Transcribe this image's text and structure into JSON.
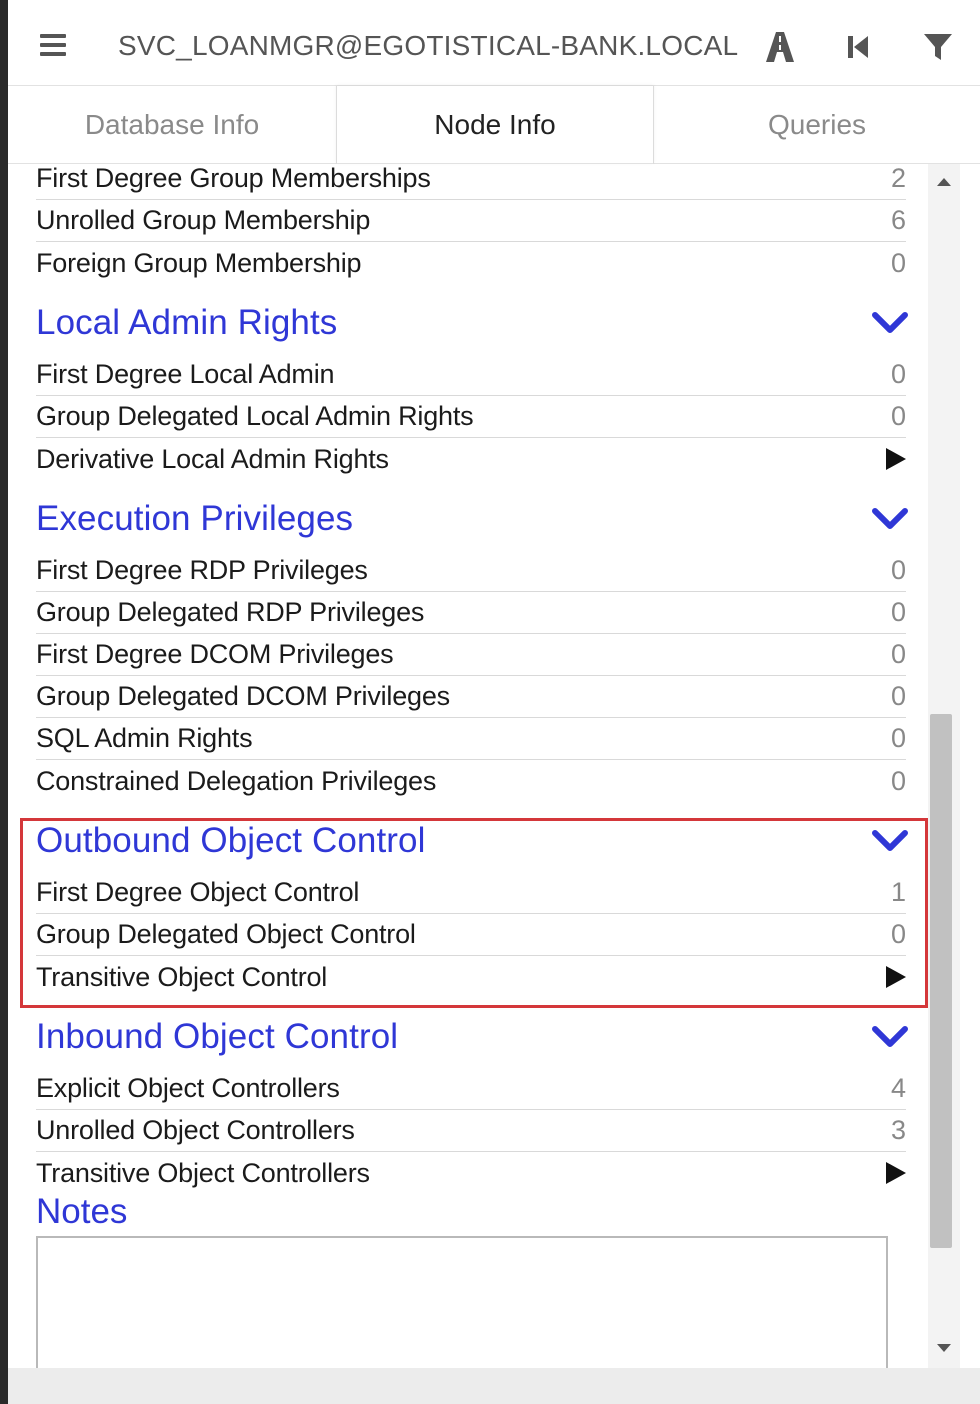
{
  "header": {
    "title": "SVC_LOANMGR@EGOTISTICAL-BANK.LOCAL",
    "icons": [
      "menu-icon",
      "pathfinding-icon",
      "back-icon",
      "filter-icon"
    ]
  },
  "tabs": [
    {
      "label": "Database Info",
      "active": false
    },
    {
      "label": "Node Info",
      "active": true
    },
    {
      "label": "Queries",
      "active": false
    }
  ],
  "group_membership_rows": [
    {
      "label": "First Degree Group Memberships",
      "value": "2"
    },
    {
      "label": "Unrolled Group Membership",
      "value": "6"
    },
    {
      "label": "Foreign Group Membership",
      "value": "0"
    }
  ],
  "local_admin": {
    "title": "Local Admin Rights",
    "rows": [
      {
        "label": "First Degree Local Admin",
        "value": "0"
      },
      {
        "label": "Group Delegated Local Admin Rights",
        "value": "0"
      },
      {
        "label": "Derivative Local Admin Rights",
        "value": ""
      }
    ]
  },
  "execution": {
    "title": "Execution Privileges",
    "rows": [
      {
        "label": "First Degree RDP Privileges",
        "value": "0"
      },
      {
        "label": "Group Delegated RDP Privileges",
        "value": "0"
      },
      {
        "label": "First Degree DCOM Privileges",
        "value": "0"
      },
      {
        "label": "Group Delegated DCOM Privileges",
        "value": "0"
      },
      {
        "label": "SQL Admin Rights",
        "value": "0"
      },
      {
        "label": "Constrained Delegation Privileges",
        "value": "0"
      }
    ]
  },
  "outbound": {
    "title": "Outbound Object Control",
    "rows": [
      {
        "label": "First Degree Object Control",
        "value": "1"
      },
      {
        "label": "Group Delegated Object Control",
        "value": "0"
      },
      {
        "label": "Transitive Object Control",
        "value": ""
      }
    ]
  },
  "inbound": {
    "title": "Inbound Object Control",
    "rows": [
      {
        "label": "Explicit Object Controllers",
        "value": "4"
      },
      {
        "label": "Unrolled Object Controllers",
        "value": "3"
      },
      {
        "label": "Transitive Object Controllers",
        "value": ""
      }
    ]
  },
  "notes": {
    "title": "Notes",
    "value": ""
  },
  "colors": {
    "section_title": "#2f37d6",
    "highlight": "#d4373a"
  }
}
